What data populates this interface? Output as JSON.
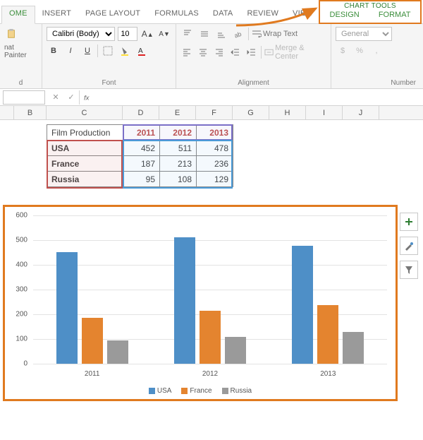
{
  "tabs": {
    "home": "OME",
    "insert": "INSERT",
    "pagelayout": "PAGE LAYOUT",
    "formulas": "FORMULAS",
    "data": "DATA",
    "review": "REVIEW",
    "view": "VIEW"
  },
  "charttools": {
    "title": "CHART TOOLS",
    "design": "DESIGN",
    "format": "FORMAT"
  },
  "ribbon": {
    "clipboard": {
      "label": "d",
      "painter": "nat Painter"
    },
    "font": {
      "label": "Font",
      "family": "Calibri (Body)",
      "size": "10",
      "bold": "B",
      "italic": "I",
      "underline": "U"
    },
    "alignment": {
      "label": "Alignment",
      "wrap": "Wrap Text",
      "merge": "Merge & Center"
    },
    "number": {
      "label": "Number",
      "general": "General"
    }
  },
  "columns": {
    "B": "B",
    "C": "C",
    "D": "D",
    "E": "E",
    "F": "F",
    "G": "G",
    "H": "H",
    "I": "I",
    "J": "J"
  },
  "table": {
    "corner": "Film Production",
    "years": [
      "2011",
      "2012",
      "2013"
    ],
    "rows": [
      {
        "label": "USA",
        "vals": [
          "452",
          "511",
          "478"
        ]
      },
      {
        "label": "France",
        "vals": [
          "187",
          "213",
          "236"
        ]
      },
      {
        "label": "Russia",
        "vals": [
          "95",
          "108",
          "129"
        ]
      }
    ]
  },
  "chart_data": {
    "type": "bar",
    "categories": [
      "2011",
      "2012",
      "2013"
    ],
    "series": [
      {
        "name": "USA",
        "values": [
          452,
          511,
          478
        ]
      },
      {
        "name": "France",
        "values": [
          187,
          213,
          236
        ]
      },
      {
        "name": "Russia",
        "values": [
          95,
          108,
          129
        ]
      }
    ],
    "title": "",
    "xlabel": "",
    "ylabel": "",
    "ylim": [
      0,
      600
    ],
    "ytick": 100,
    "legend_position": "bottom",
    "colors": {
      "USA": "#4e8fc7",
      "France": "#e4842f",
      "Russia": "#9a9a9a"
    }
  }
}
